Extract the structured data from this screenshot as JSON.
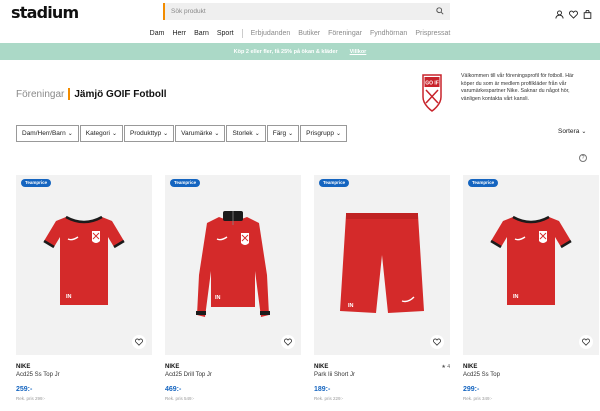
{
  "header": {
    "logo": "stadium",
    "search_placeholder": "Sök produkt",
    "icons": [
      "user-icon",
      "heart-icon",
      "bag-icon"
    ]
  },
  "nav": {
    "primary": [
      "Dam",
      "Herr",
      "Barn",
      "Sport"
    ],
    "secondary": [
      "Erbjudanden",
      "Butiker",
      "Föreningar",
      "Fyndhörnan",
      "Prispressat"
    ]
  },
  "promo": {
    "text": "Köp 2 eller fler, få 25% på ökan & kläder",
    "link": "Villkor"
  },
  "page": {
    "crumb": "Föreningar",
    "club": "Jämjö GOIF Fotboll",
    "crest_text": "GO IF",
    "intro": "Välkommen till vår föreningsprofil för fotboll. Här köper du som är medlem profilkläder från vår varumärkespartner Nike. Saknar du något hör, vänligen kontakta vårt kansli."
  },
  "filters": [
    "Dam/Herr/Barn",
    "Kategori",
    "Produkttyp",
    "Varumärke",
    "Storlek",
    "Färg",
    "Prisgrupp"
  ],
  "sort_label": "Sortera",
  "help_label": "?",
  "products": [
    {
      "badge": "Teamprice",
      "brand": "NIKE",
      "name": "Acd25 Ss Top Jr",
      "price": "259:-",
      "ref": "Rek. pris 299:-",
      "rating": ""
    },
    {
      "badge": "Teamprice",
      "brand": "NIKE",
      "name": "Acd25 Drill Top Jr",
      "price": "469:-",
      "ref": "Rek. pris 549:-",
      "rating": ""
    },
    {
      "badge": "Teamprice",
      "brand": "NIKE",
      "name": "Park Iii Short Jr",
      "price": "189:-",
      "ref": "Rek. pris 229:-",
      "rating": "★ 4"
    },
    {
      "badge": "Teamprice",
      "brand": "NIKE",
      "name": "Acd25 Ss Top",
      "price": "299:-",
      "ref": "Rek. pris 349:-",
      "rating": ""
    }
  ],
  "colors": {
    "accent": "#f28c00",
    "promo_bg": "#abd9c7",
    "price": "#1565c0",
    "product_red": "#d42a2a"
  }
}
